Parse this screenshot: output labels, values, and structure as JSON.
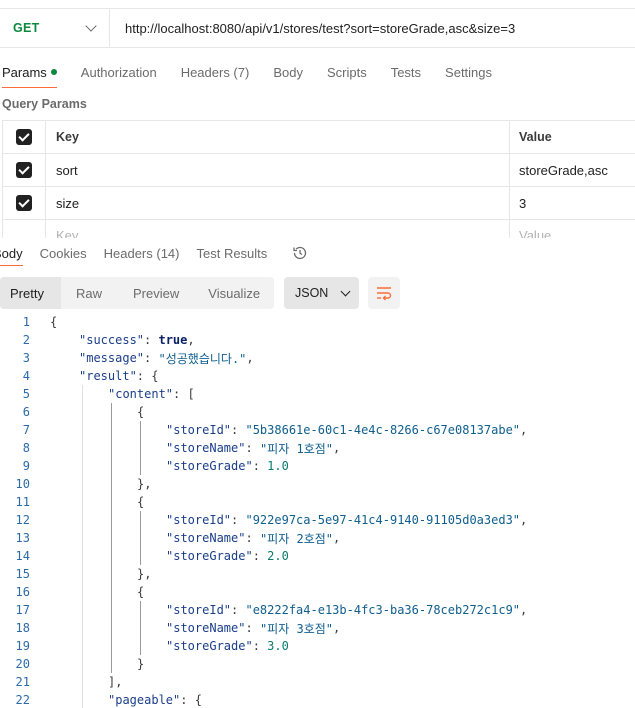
{
  "request": {
    "method": "GET",
    "url": "http://localhost:8080/api/v1/stores/test?sort=storeGrade,asc&size=3"
  },
  "request_tabs": [
    "Params",
    "Authorization",
    "Headers (7)",
    "Body",
    "Scripts",
    "Tests",
    "Settings"
  ],
  "query_params_title": "Query Params",
  "params_table": {
    "headers": {
      "key": "Key",
      "value": "Value"
    },
    "rows": [
      {
        "key": "sort",
        "value": "storeGrade,asc",
        "checked": true
      },
      {
        "key": "size",
        "value": "3",
        "checked": true
      }
    ],
    "placeholder": {
      "key": "Key",
      "value": "Value"
    }
  },
  "response_tabs": [
    "Body",
    "Cookies",
    "Headers (14)",
    "Test Results"
  ],
  "view_modes": [
    "Pretty",
    "Raw",
    "Preview",
    "Visualize"
  ],
  "format": "JSON",
  "code_lines": [
    {
      "n": "1",
      "indent": 0,
      "tokens": [
        [
          "p",
          "{"
        ]
      ]
    },
    {
      "n": "2",
      "indent": 1,
      "tokens": [
        [
          "k",
          "\"success\""
        ],
        [
          "p",
          ": "
        ],
        [
          "b",
          "true"
        ],
        [
          "p",
          ","
        ]
      ]
    },
    {
      "n": "3",
      "indent": 1,
      "tokens": [
        [
          "k",
          "\"message\""
        ],
        [
          "p",
          ": "
        ],
        [
          "s",
          "\"성공했습니다.\""
        ],
        [
          "p",
          ","
        ]
      ]
    },
    {
      "n": "4",
      "indent": 1,
      "tokens": [
        [
          "k",
          "\"result\""
        ],
        [
          "p",
          ": {"
        ]
      ]
    },
    {
      "n": "5",
      "indent": 2,
      "tokens": [
        [
          "k",
          "\"content\""
        ],
        [
          "p",
          ": ["
        ]
      ]
    },
    {
      "n": "6",
      "indent": 3,
      "tokens": [
        [
          "p",
          "{"
        ]
      ]
    },
    {
      "n": "7",
      "indent": 4,
      "tokens": [
        [
          "k",
          "\"storeId\""
        ],
        [
          "p",
          ": "
        ],
        [
          "s",
          "\"5b38661e-60c1-4e4c-8266-c67e08137abe\""
        ],
        [
          "p",
          ","
        ]
      ]
    },
    {
      "n": "8",
      "indent": 4,
      "tokens": [
        [
          "k",
          "\"storeName\""
        ],
        [
          "p",
          ": "
        ],
        [
          "s",
          "\"피자 1호점\""
        ],
        [
          "p",
          ","
        ]
      ]
    },
    {
      "n": "9",
      "indent": 4,
      "tokens": [
        [
          "k",
          "\"storeGrade\""
        ],
        [
          "p",
          ": "
        ],
        [
          "n",
          "1.0"
        ]
      ]
    },
    {
      "n": "10",
      "indent": 3,
      "tokens": [
        [
          "p",
          "},"
        ]
      ]
    },
    {
      "n": "11",
      "indent": 3,
      "tokens": [
        [
          "p",
          "{"
        ]
      ]
    },
    {
      "n": "12",
      "indent": 4,
      "tokens": [
        [
          "k",
          "\"storeId\""
        ],
        [
          "p",
          ": "
        ],
        [
          "s",
          "\"922e97ca-5e97-41c4-9140-91105d0a3ed3\""
        ],
        [
          "p",
          ","
        ]
      ]
    },
    {
      "n": "13",
      "indent": 4,
      "tokens": [
        [
          "k",
          "\"storeName\""
        ],
        [
          "p",
          ": "
        ],
        [
          "s",
          "\"피자 2호점\""
        ],
        [
          "p",
          ","
        ]
      ]
    },
    {
      "n": "14",
      "indent": 4,
      "tokens": [
        [
          "k",
          "\"storeGrade\""
        ],
        [
          "p",
          ": "
        ],
        [
          "n",
          "2.0"
        ]
      ]
    },
    {
      "n": "15",
      "indent": 3,
      "tokens": [
        [
          "p",
          "},"
        ]
      ]
    },
    {
      "n": "16",
      "indent": 3,
      "tokens": [
        [
          "p",
          "{"
        ]
      ]
    },
    {
      "n": "17",
      "indent": 4,
      "tokens": [
        [
          "k",
          "\"storeId\""
        ],
        [
          "p",
          ": "
        ],
        [
          "s",
          "\"e8222fa4-e13b-4fc3-ba36-78ceb272c1c9\""
        ],
        [
          "p",
          ","
        ]
      ]
    },
    {
      "n": "18",
      "indent": 4,
      "tokens": [
        [
          "k",
          "\"storeName\""
        ],
        [
          "p",
          ": "
        ],
        [
          "s",
          "\"피자 3호점\""
        ],
        [
          "p",
          ","
        ]
      ]
    },
    {
      "n": "19",
      "indent": 4,
      "tokens": [
        [
          "k",
          "\"storeGrade\""
        ],
        [
          "p",
          ": "
        ],
        [
          "n",
          "3.0"
        ]
      ]
    },
    {
      "n": "20",
      "indent": 3,
      "tokens": [
        [
          "p",
          "}"
        ]
      ]
    },
    {
      "n": "21",
      "indent": 2,
      "tokens": [
        [
          "p",
          "],"
        ]
      ]
    },
    {
      "n": "22",
      "indent": 2,
      "tokens": [
        [
          "k",
          "\"pageable\""
        ],
        [
          "p",
          ": {"
        ]
      ]
    }
  ],
  "icons": {
    "history": "history-icon",
    "wrap": "wrap-lines-icon",
    "method_dropdown": "chevron-down-icon"
  },
  "colors": {
    "accent": "#ff6c37",
    "get_method": "#0b8a3e"
  }
}
